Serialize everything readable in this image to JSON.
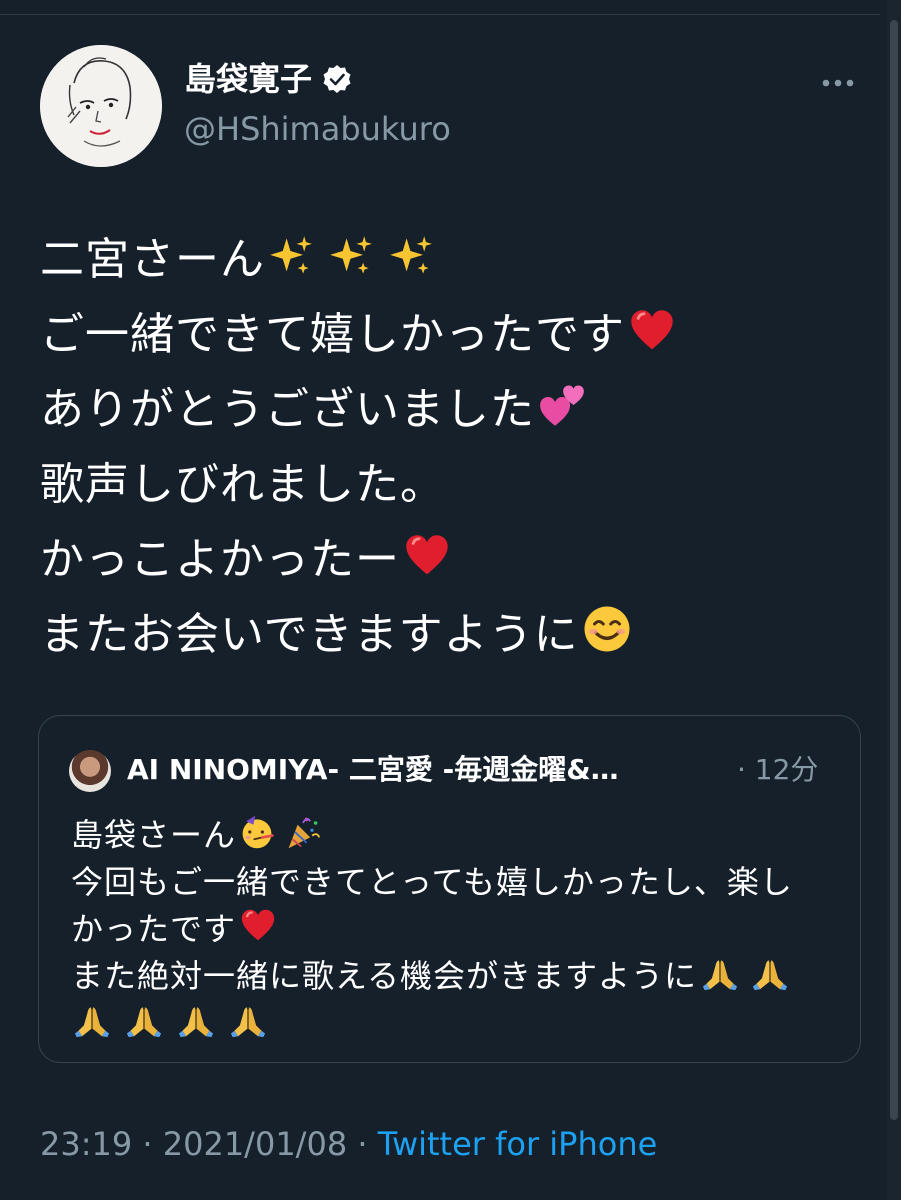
{
  "author": {
    "display_name": "島袋寛子",
    "handle": "@HShimabukuro"
  },
  "tweet": {
    "lines": [
      "二宮さーん",
      "ご一緒できて嬉しかったです",
      "ありがとうございました",
      "歌声しびれました。",
      "かっこよかったー",
      "またお会いできますように"
    ],
    "emojis": {
      "line1": "sparkles-icon",
      "line2": "red-heart-icon",
      "line3": "two-hearts-icon",
      "line5": "red-heart-icon",
      "line6": "smiling-face-icon"
    }
  },
  "quoted_tweet": {
    "author": "AI NINOMIYA- 二宮愛 -毎週金曜&…",
    "time": "· 12分",
    "lines": [
      "島袋さーん",
      "今回もご一緒できてとっても嬉しかったし、楽し",
      "かったです",
      "また絶対一緒に歌える機会がきますように",
      ""
    ],
    "emojis": {
      "line1": [
        "partying-face-icon",
        "party-popper-icon"
      ],
      "line3": "red-heart-icon",
      "line4": [
        "folded-hands-icon",
        "folded-hands-icon"
      ],
      "line5": [
        "folded-hands-icon",
        "folded-hands-icon",
        "folded-hands-icon",
        "folded-hands-icon"
      ]
    }
  },
  "footer": {
    "meta": "23:19 · 2021/01/08 · ",
    "source": "Twitter for iPhone"
  },
  "colors": {
    "background": "#15202b",
    "secondary_text": "#8899a6",
    "link": "#1da1f2",
    "border": "#38444d"
  }
}
